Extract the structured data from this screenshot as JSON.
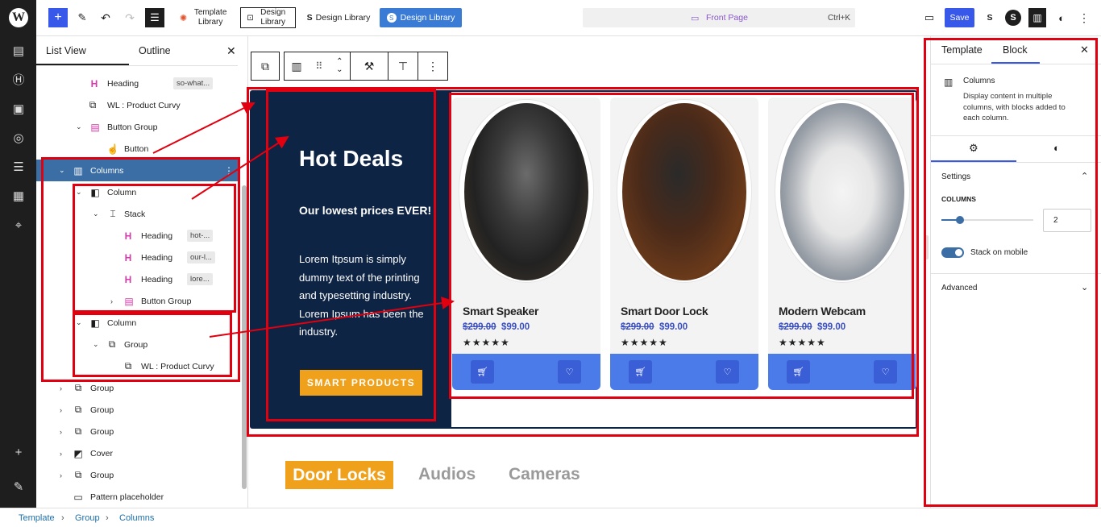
{
  "topbar": {
    "template_library_label": "Template Library",
    "design_library_label": "Design Library",
    "design_library_label2": "Design Library",
    "design_library_active_label": "Design Library",
    "doc_title": "Front Page",
    "shortcut": "Ctrl+K",
    "save_label": "Save"
  },
  "listview": {
    "tab_list": "List View",
    "tab_outline": "Outline",
    "rows": [
      {
        "label": "Heading",
        "tag": "so-what..."
      },
      {
        "label": "WL : Product Curvy"
      },
      {
        "label": "Button Group"
      },
      {
        "label": "Button"
      },
      {
        "label": "Columns"
      },
      {
        "label": "Column"
      },
      {
        "label": "Stack"
      },
      {
        "label": "Heading",
        "tag": "hot-..."
      },
      {
        "label": "Heading",
        "tag": "our-l..."
      },
      {
        "label": "Heading",
        "tag": "lore..."
      },
      {
        "label": "Button Group"
      },
      {
        "label": "Column"
      },
      {
        "label": "Group"
      },
      {
        "label": "WL : Product Curvy"
      },
      {
        "label": "Group"
      },
      {
        "label": "Group"
      },
      {
        "label": "Group"
      },
      {
        "label": "Cover"
      },
      {
        "label": "Group"
      },
      {
        "label": "Pattern placeholder"
      }
    ]
  },
  "canvas": {
    "hot_title": "Hot Deals",
    "hot_subtitle": "Our lowest prices EVER!",
    "hot_body": "Lorem Itpsum is simply dummy  text of the printing and typesetting  industry. Lorem Ipsum has been the industry.",
    "hot_button": "SMART PRODUCTS",
    "products": [
      {
        "title": "Smart Speaker",
        "old_price": "$299.00",
        "new_price": "$99.00",
        "stars": "★★★★★"
      },
      {
        "title": "Smart Door Lock",
        "old_price": "$299.00",
        "new_price": "$99.00",
        "stars": "★★★★★"
      },
      {
        "title": "Modern Webcam",
        "old_price": "$299.00",
        "new_price": "$99.00",
        "stars": "★★★★★"
      }
    ],
    "tabs": [
      "Door Locks",
      "Audios",
      "Cameras"
    ]
  },
  "rightpanel": {
    "tab_template": "Template",
    "tab_block": "Block",
    "block_name": "Columns",
    "block_desc": "Display content in multiple columns, with blocks added to each column.",
    "settings_label": "Settings",
    "columns_label": "COLUMNS",
    "columns_value": "2",
    "columns_slider_fraction": 0.2,
    "stack_label": "Stack on mobile",
    "advanced_label": "Advanced"
  },
  "breadcrumb": [
    "Template",
    "Group",
    "Columns"
  ],
  "colors": {
    "accent": "#3858e9",
    "hot_bg": "#0e2444",
    "cta": "#f0a11b",
    "card_bar": "#4a7be8",
    "annotation": "#e0000f"
  }
}
